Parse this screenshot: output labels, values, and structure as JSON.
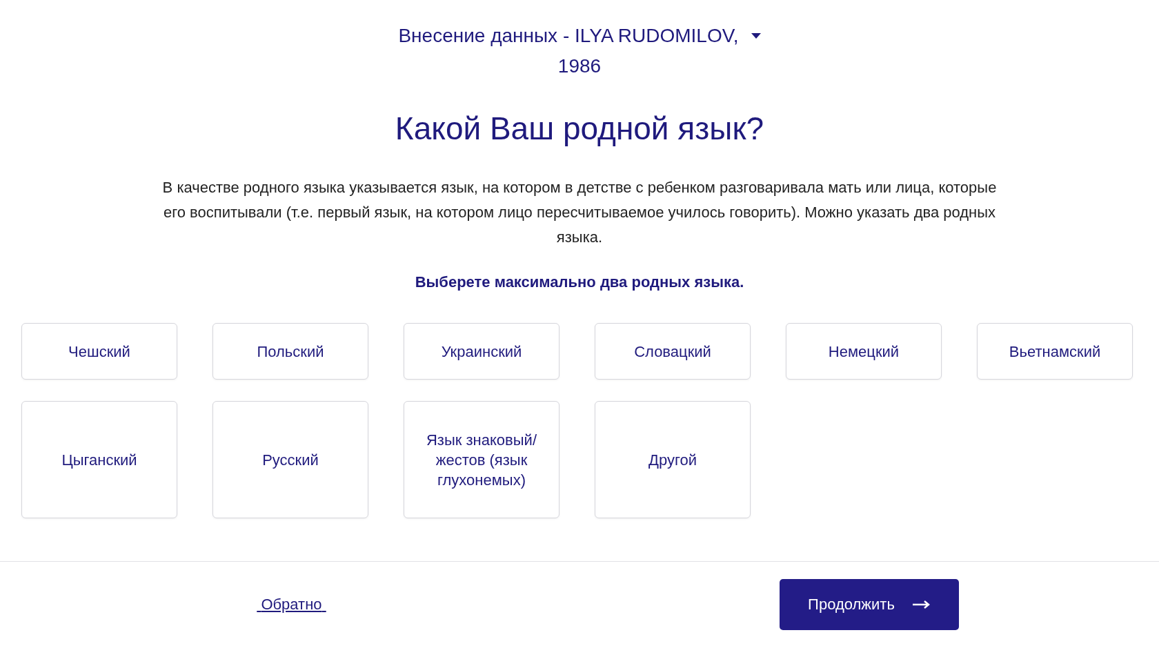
{
  "header": {
    "title": "Внесение данных - ILYA RUDOMILOV,",
    "year": "1986"
  },
  "question": "Какой Ваш родной язык?",
  "description": "В качестве родного языка указывается язык, на котором в детстве с ребенком разговаривала мать или лица, которые его воспитывали (т.е. первый язык, на котором лицо пересчитываемое училось говорить). Можно указать два родных языка.",
  "instruction": "Выберете максимально два родных языка.",
  "options": [
    {
      "label": "Чешский",
      "selected": false
    },
    {
      "label": "Польский",
      "selected": false
    },
    {
      "label": "Украинский",
      "selected": false
    },
    {
      "label": "Словацкий",
      "selected": false
    },
    {
      "label": "Немецкий",
      "selected": false
    },
    {
      "label": "Вьетнамский",
      "selected": false
    },
    {
      "label": "Цыганский",
      "selected": false
    },
    {
      "label": "Русский",
      "selected": false
    },
    {
      "label": "Язык знаковый/ жестов (язык глухонемых)",
      "selected": false
    },
    {
      "label": "Другой",
      "selected": false
    }
  ],
  "footer": {
    "back": "Обратно",
    "continue": "Продолжить"
  }
}
